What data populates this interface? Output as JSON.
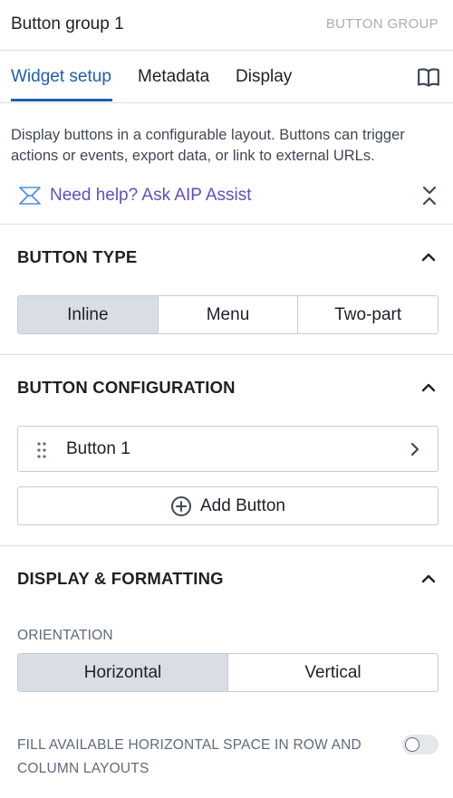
{
  "header": {
    "title": "Button group 1",
    "widget_type": "BUTTON GROUP"
  },
  "tabs": [
    {
      "label": "Widget setup",
      "active": true
    },
    {
      "label": "Metadata",
      "active": false
    },
    {
      "label": "Display",
      "active": false
    }
  ],
  "description": "Display buttons in a configurable layout. Buttons can trigger actions or events, export data, or link to external URLs.",
  "help": {
    "label": "Need help? Ask AIP Assist"
  },
  "button_type": {
    "title": "BUTTON TYPE",
    "options": [
      "Inline",
      "Menu",
      "Two-part"
    ],
    "selected": "Inline"
  },
  "button_config": {
    "title": "BUTTON CONFIGURATION",
    "buttons": [
      {
        "label": "Button 1"
      }
    ],
    "add_label": "Add Button"
  },
  "display": {
    "title": "DISPLAY & FORMATTING",
    "orientation_label": "ORIENTATION",
    "orientation_options": [
      "Horizontal",
      "Vertical"
    ],
    "orientation_selected": "Horizontal",
    "fill_label_line1": "FILL AVAILABLE HORIZONTAL SPACE IN ROW AND",
    "fill_label_line2": "COLUMN LAYOUTS",
    "fill_enabled": false
  },
  "colors": {
    "accent": "#215db0",
    "aip": "#634dbf",
    "selected_bg": "#d9dee6",
    "border": "#c5cbd3"
  }
}
